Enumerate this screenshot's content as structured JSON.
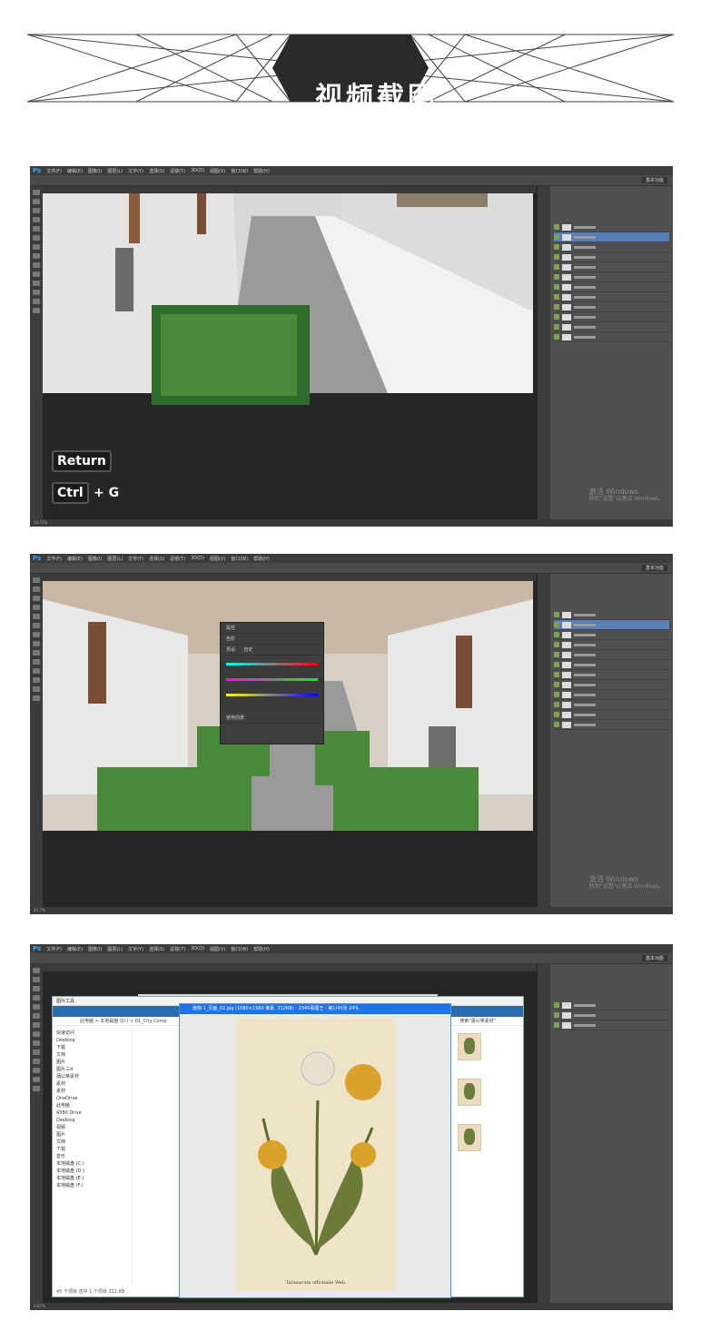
{
  "header": {
    "title": "视频截图"
  },
  "screenshots": [
    {
      "menu": [
        "Ps",
        "文件(F)",
        "编辑(E)",
        "图像(I)",
        "图层(L)",
        "文字(Y)",
        "选择(S)",
        "滤镜(T)",
        "3D(D)",
        "视图(V)",
        "窗口(W)",
        "帮助(H)"
      ],
      "workspace": "基本功能",
      "keys": {
        "return": "Return",
        "ctrl": "Ctrl",
        "plus_g": "+ G"
      },
      "watermark": {
        "line1": "激活 Windows",
        "line2": "转到\"设置\"以激活 Windows。"
      },
      "status": "33.73%"
    },
    {
      "menu": [
        "Ps",
        "文件(F)",
        "编辑(E)",
        "图像(I)",
        "图层(L)",
        "文字(Y)",
        "选择(S)",
        "滤镜(T)",
        "3D(D)",
        "视图(V)",
        "窗口(W)",
        "帮助(H)"
      ],
      "workspace": "基本功能",
      "dialog": {
        "title": "属性",
        "tab": "色阶",
        "preset_label": "预设:",
        "preset_value": "自定",
        "check": "使用前景"
      },
      "watermark": {
        "line1": "激活 Windows",
        "line2": "转到\"设置\"以激活 Windows。"
      },
      "status": "25.7%"
    },
    {
      "menu": [
        "Ps",
        "文件(F)",
        "编辑(E)",
        "图像(I)",
        "图层(L)",
        "文字(Y)",
        "选择(S)",
        "滤镜(T)",
        "3D(D)",
        "视图(V)",
        "窗口(W)",
        "帮助(H)"
      ],
      "workspace": "基本功能",
      "explorer": {
        "title": "图片工具",
        "path": "此电脑 > 本地磁盘 (D:) > 01_City Comp",
        "search": "搜索\"蒲公英素材\"",
        "nav": [
          "快速访问",
          "Desktop",
          "下载",
          "文档",
          "图片",
          "图片三d",
          "蒲公英素材",
          "素材",
          "素材",
          "OneDrive",
          "此电脑",
          "4380 Drive",
          "Desktop",
          "视频",
          "图片",
          "文档",
          "下载",
          "音乐",
          "本地磁盘 (C:)",
          "本地磁盘 (D:)",
          "本地磁盘 (E:)",
          "本地磁盘 (F:)"
        ],
        "status": "45 个项目   选中 1 个项目  312 KB"
      },
      "viewer": {
        "title": "植物 1_页面_02.jpg (1080×1560 像素, 312KB) - 2345看图王 - 第1/45张 24%",
        "caption": "Taraxacum officinale Web."
      },
      "status": "6.67%"
    }
  ]
}
